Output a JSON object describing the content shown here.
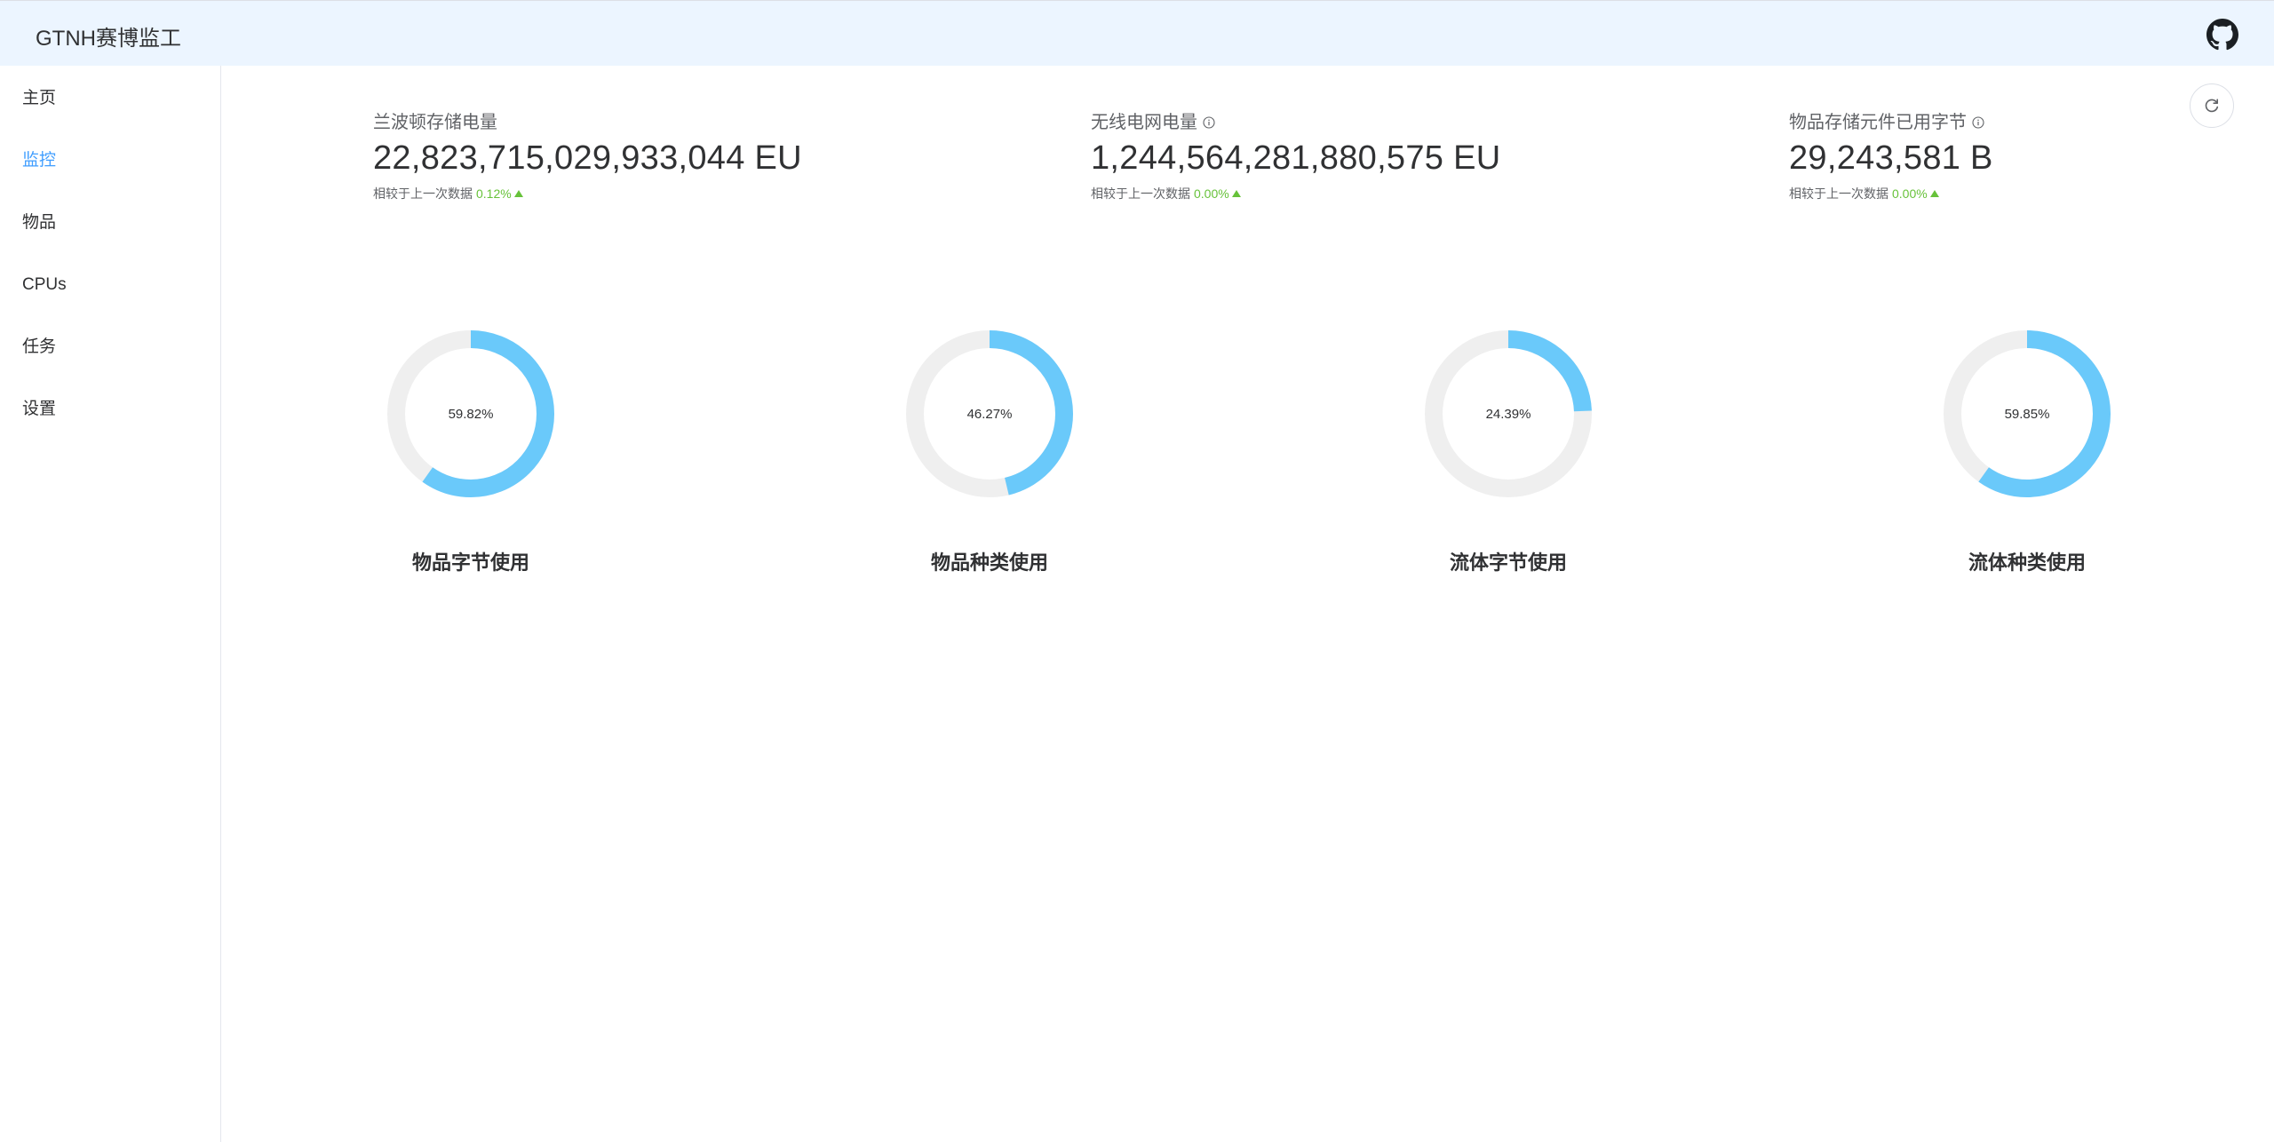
{
  "header": {
    "title": "GTNH赛博监工"
  },
  "sidebar": {
    "items": [
      {
        "label": "主页"
      },
      {
        "label": "监控"
      },
      {
        "label": "物品"
      },
      {
        "label": "CPUs"
      },
      {
        "label": "任务"
      },
      {
        "label": "设置"
      }
    ],
    "active_index": 1
  },
  "stats": [
    {
      "title": "兰波顿存储电量",
      "value": "22,823,715,029,933,044 EU",
      "compare_label": "相较于上一次数据",
      "change": "0.12%",
      "trend": "up",
      "has_info": false
    },
    {
      "title": "无线电网电量",
      "value": "1,244,564,281,880,575 EU",
      "compare_label": "相较于上一次数据",
      "change": "0.00%",
      "trend": "up",
      "has_info": true
    },
    {
      "title": "物品存储元件已用字节",
      "value": "29,243,581 B",
      "compare_label": "相较于上一次数据",
      "change": "0.00%",
      "trend": "up",
      "has_info": true
    }
  ],
  "gauges": [
    {
      "label": "物品字节使用",
      "percent": 59.82,
      "percent_text": "59.82%"
    },
    {
      "label": "物品种类使用",
      "percent": 46.27,
      "percent_text": "46.27%"
    },
    {
      "label": "流体字节使用",
      "percent": 24.39,
      "percent_text": "24.39%"
    },
    {
      "label": "流体种类使用",
      "percent": 59.85,
      "percent_text": "59.85%"
    }
  ],
  "colors": {
    "header_bg": "#ecf5ff",
    "accent": "#409eff",
    "gauge_fill": "#6ac9fa",
    "gauge_track": "#efefef",
    "trend_up": "#67c23a"
  },
  "icons": {
    "github": "github-icon",
    "refresh": "refresh-icon",
    "info": "info-icon",
    "trend_up": "caret-up-icon"
  }
}
